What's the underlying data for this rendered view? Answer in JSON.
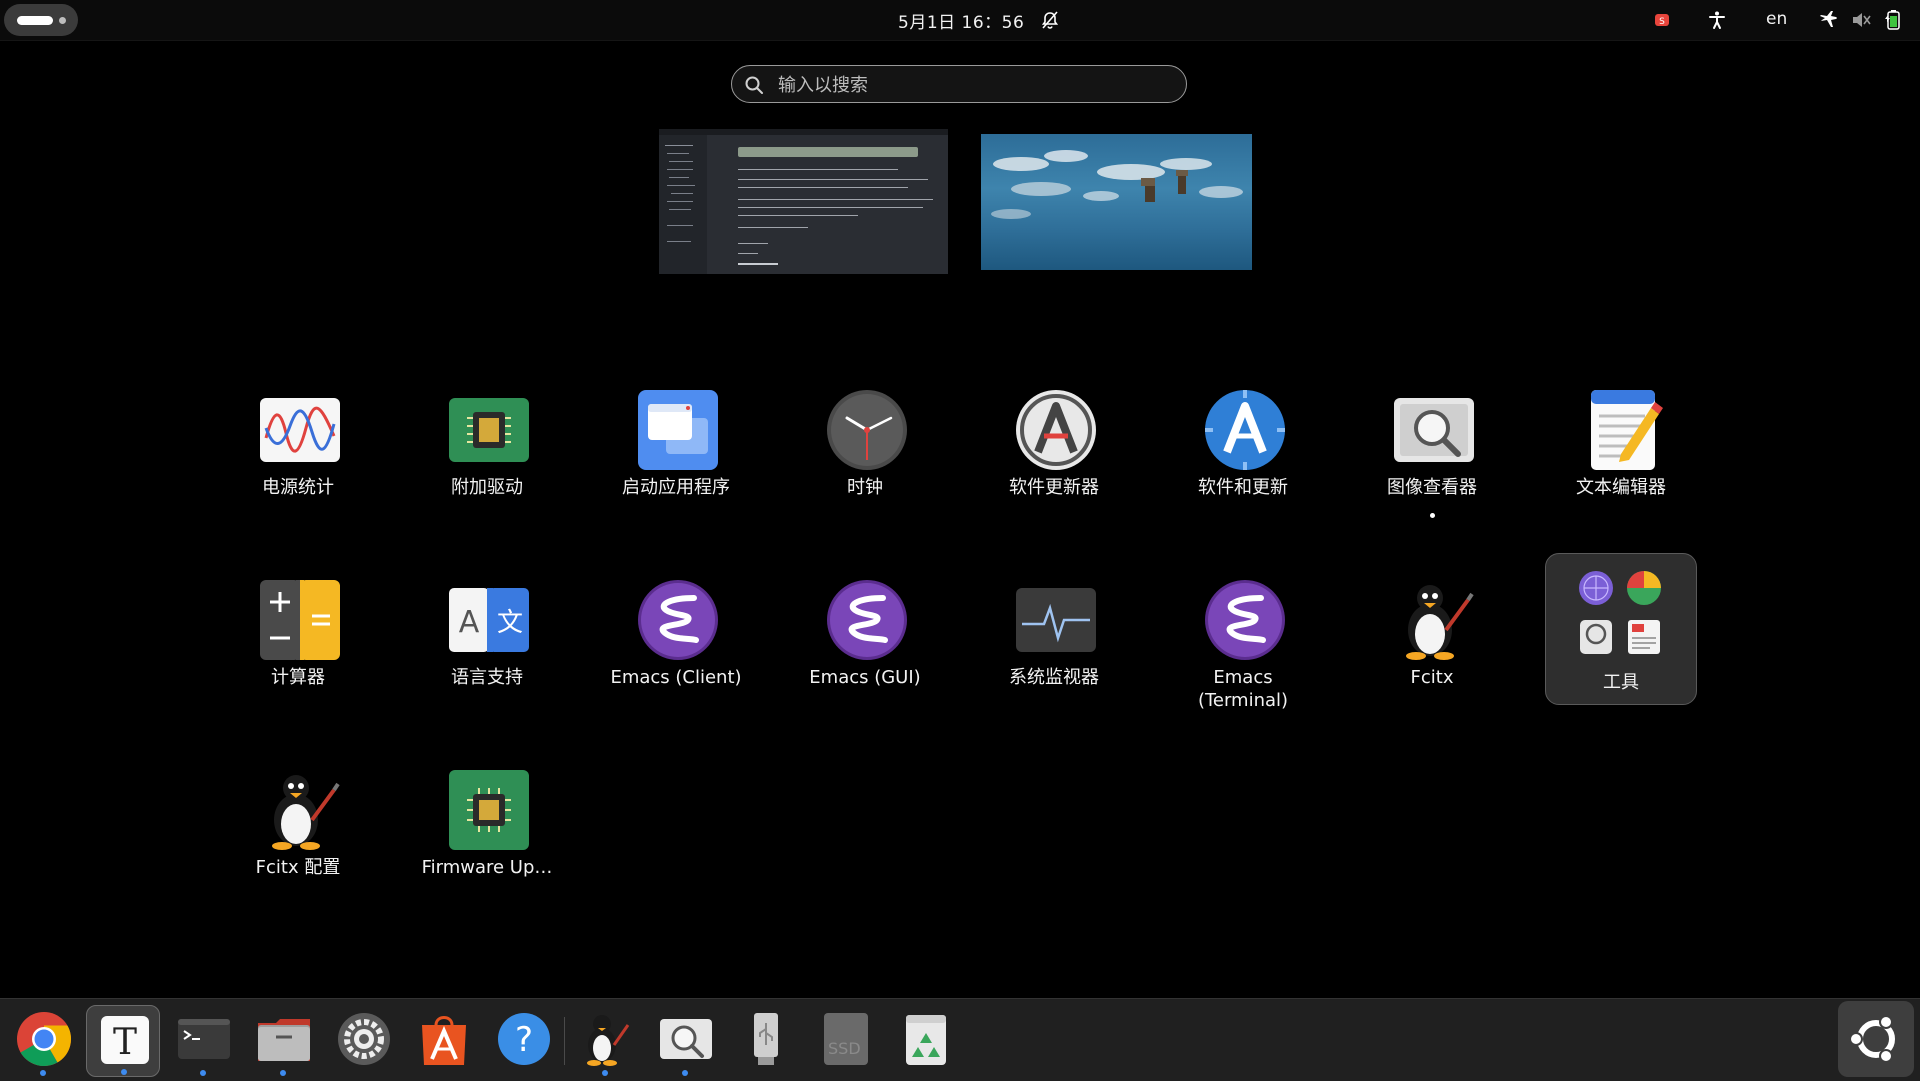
{
  "topbar": {
    "clock": "5月1日 16：56",
    "language": "en",
    "icons": [
      "activities-indicator",
      "notifications-off-icon",
      "indicator-app-icon",
      "accessibility-icon",
      "airplane-mode-icon",
      "volume-muted-icon",
      "battery-icon"
    ]
  },
  "search": {
    "placeholder": "输入以搜索"
  },
  "workspaces": [
    {
      "name": "workspace-1",
      "content": "document editor window"
    },
    {
      "name": "workspace-2",
      "content": "desktop wallpaper"
    }
  ],
  "apps": [
    {
      "label": "电源统计",
      "icon": "power-statistics-icon"
    },
    {
      "label": "附加驱动",
      "icon": "additional-drivers-icon"
    },
    {
      "label": "启动应用程序",
      "icon": "startup-applications-icon"
    },
    {
      "label": "时钟",
      "icon": "clock-icon"
    },
    {
      "label": "软件更新器",
      "icon": "software-updater-icon"
    },
    {
      "label": "软件和更新",
      "icon": "software-and-updates-icon"
    },
    {
      "label": "图像查看器",
      "icon": "image-viewer-icon"
    },
    {
      "label": "文本编辑器",
      "icon": "text-editor-icon"
    },
    {
      "label": "计算器",
      "icon": "calculator-icon"
    },
    {
      "label": "语言支持",
      "icon": "language-support-icon"
    },
    {
      "label": "Emacs (Client)",
      "icon": "emacs-icon"
    },
    {
      "label": "Emacs (GUI)",
      "icon": "emacs-icon"
    },
    {
      "label": "系统监视器",
      "icon": "system-monitor-icon"
    },
    {
      "label": "Emacs (Terminal)",
      "icon": "emacs-icon"
    },
    {
      "label": "Fcitx",
      "icon": "fcitx-penguin-icon"
    },
    {
      "label": "Fcitx 配置",
      "icon": "fcitx-penguin-icon"
    },
    {
      "label": "Firmware Up…",
      "icon": "firmware-updater-icon"
    }
  ],
  "folder": {
    "label": "工具"
  },
  "dock": [
    {
      "name": "chrome",
      "icon": "chrome-icon",
      "running": true
    },
    {
      "name": "text-editor",
      "icon": "text-editor-t-icon",
      "running": true,
      "active": true
    },
    {
      "name": "terminal",
      "icon": "terminal-icon",
      "running": true
    },
    {
      "name": "files",
      "icon": "files-icon",
      "running": true
    },
    {
      "name": "settings",
      "icon": "settings-icon",
      "running": false
    },
    {
      "name": "app-center",
      "icon": "app-center-icon",
      "running": false
    },
    {
      "name": "help",
      "icon": "help-icon",
      "running": false
    },
    {
      "name": "fcitx",
      "icon": "fcitx-penguin-icon",
      "running": true
    },
    {
      "name": "image-viewer",
      "icon": "image-viewer-icon",
      "running": true
    },
    {
      "name": "usb-drive",
      "icon": "usb-drive-icon",
      "running": false
    },
    {
      "name": "ssd-drive",
      "icon": "ssd-drive-icon",
      "label": "SSD",
      "running": false
    },
    {
      "name": "trash",
      "icon": "trash-icon",
      "running": false
    },
    {
      "name": "show-apps",
      "icon": "ubuntu-show-apps-icon"
    }
  ],
  "colors": {
    "background": "#000000",
    "dock": "#202020",
    "running_dot": "#3d8bf0",
    "emacs": "#7a46b8"
  }
}
